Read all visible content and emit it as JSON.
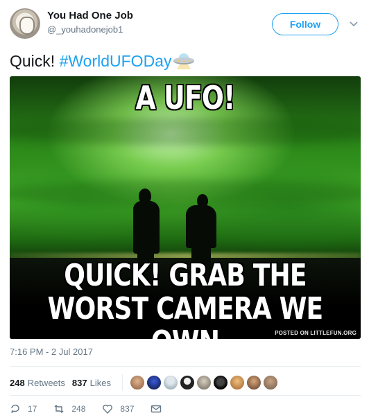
{
  "author": {
    "display_name": "You Had One Job",
    "handle": "@_youhadonejob1"
  },
  "follow_label": "Follow",
  "tweet": {
    "text_plain": "Quick! ",
    "hashtag": "#WorldUFODay",
    "emoji_icon": "flying-saucer-icon"
  },
  "media": {
    "top_caption": "A UFO!",
    "bottom_caption_line1": "QUICK! GRAB THE",
    "bottom_caption_line2": "WORST CAMERA WE OWN",
    "credit": "POSTED ON LITTLEFUN.ORG"
  },
  "timestamp": "7:16 PM - 2 Jul 2017",
  "stats": {
    "retweets_count": "248",
    "retweets_label": "Retweets",
    "likes_count": "837",
    "likes_label": "Likes"
  },
  "actions": {
    "replies": "17",
    "retweets": "248",
    "likes": "837"
  },
  "colors": {
    "accent": "#1da1f2",
    "muted": "#657786"
  }
}
